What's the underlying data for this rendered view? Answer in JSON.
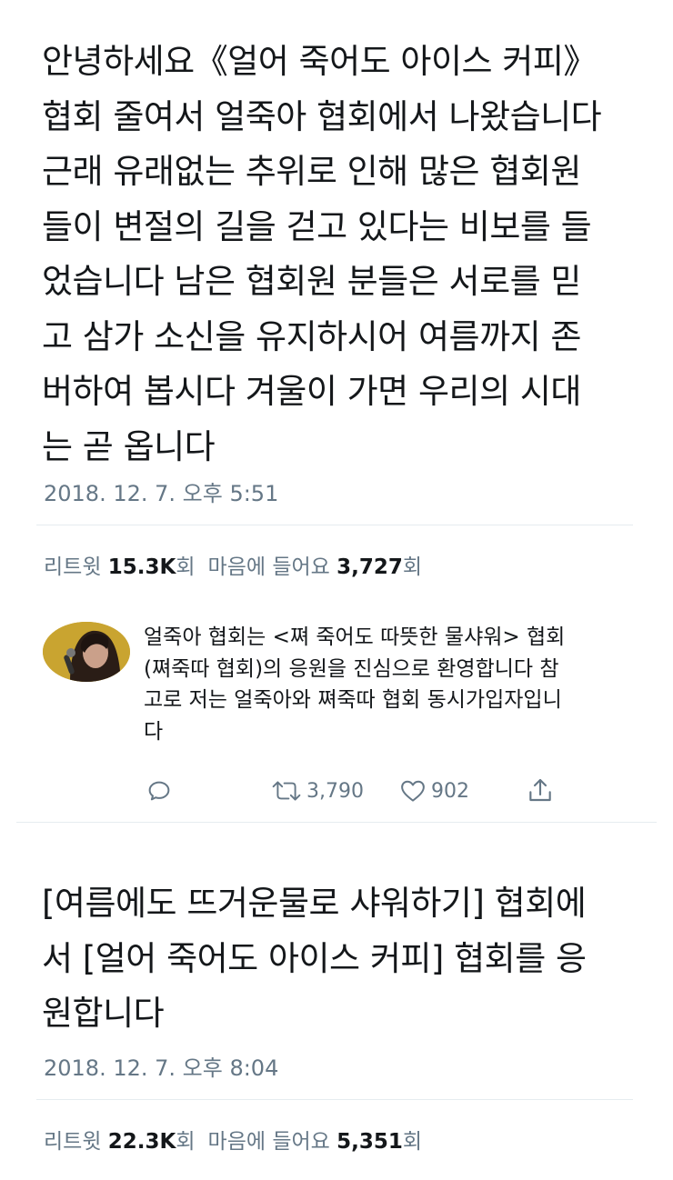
{
  "tweet1": {
    "lines": [
      "안녕하세요《얼어 죽어도 아이스 커피》",
      "협회 줄여서 얼죽아 협회에서 나왔습니다",
      "근래 유래없는 추위로 인해 많은 협회원",
      "들이 변절의 길을 걷고 있다는 비보를 들",
      "었습니다 남은 협회원 분들은 서로를 믿",
      "고 삼가 소신을 유지하시어 여름까지 존",
      "버하여 봅시다 겨울이 가면 우리의 시대",
      "는 곧 옵니다"
    ],
    "timestamp": "2018. 12. 7. 오후 5:51",
    "retweets_label": "리트윗",
    "retweets_count": "15.3K",
    "retweets_suffix": "회",
    "likes_label": "마음에 들어요",
    "likes_count": "3,727",
    "likes_suffix": "회"
  },
  "reply": {
    "lines": [
      "얼죽아 협회는 <쪄 죽어도 따뜻한 물샤워> 협회",
      "(쪄죽따 협회)의 응원을 진심으로 환영합니다 참",
      "고로 저는 얼죽아와 쪄죽따 협회 동시가입자입니",
      "다"
    ],
    "actions": {
      "reply_icon": "comment-bubble-icon",
      "retweet_icon": "retweet-icon",
      "retweet_count": "3,790",
      "like_icon": "heart-icon",
      "like_count": "902",
      "share_icon": "share-icon"
    }
  },
  "tweet2": {
    "lines": [
      "[여름에도 뜨거운물로 샤워하기] 협회에",
      "서 [얼어 죽어도 아이스 커피] 협회를 응",
      "원합니다"
    ],
    "timestamp": "2018. 12. 7. 오후 8:04",
    "retweets_label": "리트윗",
    "retweets_count": "22.3K",
    "retweets_suffix": "회",
    "likes_label": "마음에 들어요",
    "likes_count": "5,351",
    "likes_suffix": "회"
  },
  "colors": {
    "text": "#14171a",
    "secondary": "#657786",
    "divider": "#e6ecf0"
  }
}
